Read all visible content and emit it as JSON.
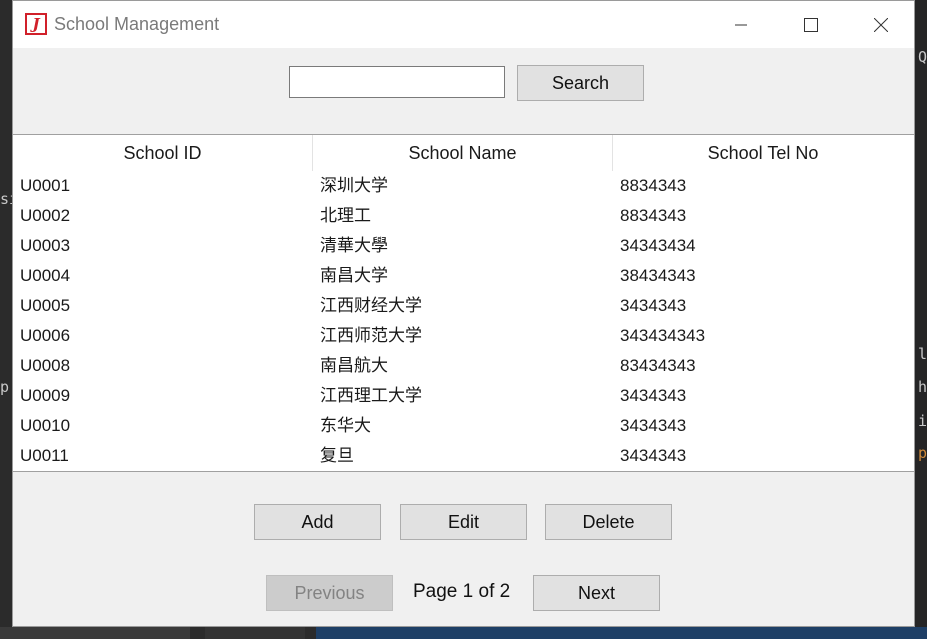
{
  "window": {
    "title": "School Management",
    "icon": "app-logo-icon"
  },
  "search": {
    "value": "",
    "placeholder": "",
    "button_label": "Search"
  },
  "table": {
    "columns": [
      "School ID",
      "School Name",
      "School Tel No"
    ],
    "rows": [
      [
        "U0001",
        "深圳大学",
        "8834343"
      ],
      [
        "U0002",
        "北理工",
        "8834343"
      ],
      [
        "U0003",
        "清華大學",
        "34343434"
      ],
      [
        "U0004",
        "南昌大学",
        "38434343"
      ],
      [
        "U0005",
        "江西财经大学",
        "3434343"
      ],
      [
        "U0006",
        "江西师范大学",
        "343434343"
      ],
      [
        "U0008",
        "南昌航大",
        "83434343"
      ],
      [
        "U0009",
        "江西理工大学",
        "3434343"
      ],
      [
        "U0010",
        "东华大",
        "3434343"
      ],
      [
        "U0011",
        "复旦",
        "3434343"
      ]
    ]
  },
  "actions": {
    "add": "Add",
    "edit": "Edit",
    "delete": "Delete"
  },
  "pagination": {
    "previous": "Previous",
    "next": "Next",
    "page_text": "Page 1 of 2",
    "previous_enabled": false
  },
  "background": {
    "chars": [
      "Q",
      "si",
      "p",
      "l",
      "h",
      "i",
      "p"
    ]
  }
}
